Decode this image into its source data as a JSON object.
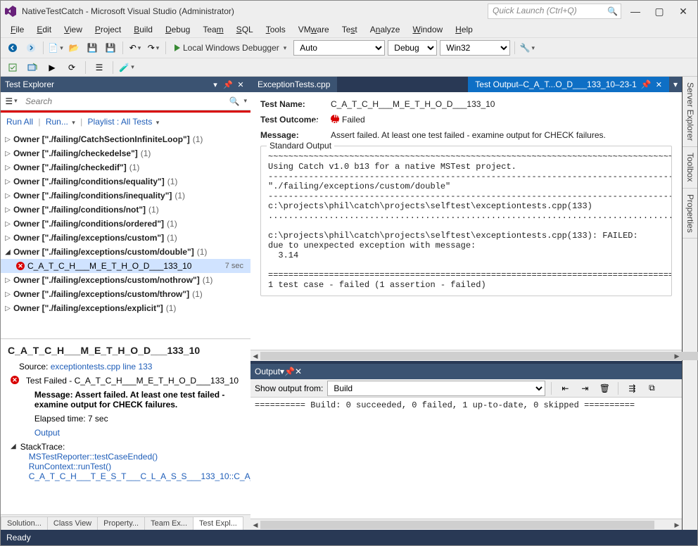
{
  "window": {
    "title": "NativeTestCatch - Microsoft Visual Studio (Administrator)",
    "quick_launch_placeholder": "Quick Launch (Ctrl+Q)"
  },
  "menu": [
    "File",
    "Edit",
    "View",
    "Project",
    "Build",
    "Debug",
    "Team",
    "SQL",
    "Tools",
    "VMware",
    "Test",
    "Analyze",
    "Window",
    "Help"
  ],
  "toolbar": {
    "run_label": "Local Windows Debugger",
    "combo_platform": "Auto",
    "combo_config": "Debug",
    "combo_arch": "Win32"
  },
  "test_explorer": {
    "title": "Test Explorer",
    "search_placeholder": "Search",
    "cmd_runall": "Run All",
    "cmd_run": "Run...",
    "cmd_playlist": "Playlist : All Tests",
    "groups": [
      {
        "label": "Owner [\"./failing/CatchSectionInfiniteLoop\"]",
        "count": "(1)",
        "open": false
      },
      {
        "label": "Owner [\"./failing/checkedelse\"]",
        "count": "(1)",
        "open": false
      },
      {
        "label": "Owner [\"./failing/checkedif\"]",
        "count": "(1)",
        "open": false
      },
      {
        "label": "Owner [\"./failing/conditions/equality\"]",
        "count": "(1)",
        "open": false
      },
      {
        "label": "Owner [\"./failing/conditions/inequality\"]",
        "count": "(1)",
        "open": false
      },
      {
        "label": "Owner [\"./failing/conditions/not\"]",
        "count": "(1)",
        "open": false
      },
      {
        "label": "Owner [\"./failing/conditions/ordered\"]",
        "count": "(1)",
        "open": false
      },
      {
        "label": "Owner [\"./failing/exceptions/custom\"]",
        "count": "(1)",
        "open": false
      },
      {
        "label": "Owner [\"./failing/exceptions/custom/double\"]",
        "count": "(1)",
        "open": true,
        "children": [
          {
            "label": "C_A_T_C_H___M_E_T_H_O_D___133_10",
            "time": "7 sec",
            "failed": true
          }
        ]
      },
      {
        "label": "Owner [\"./failing/exceptions/custom/nothrow\"]",
        "count": "(1)",
        "open": false
      },
      {
        "label": "Owner [\"./failing/exceptions/custom/throw\"]",
        "count": "(1)",
        "open": false
      },
      {
        "label": "Owner [\"./failing/exceptions/explicit\"]",
        "count": "(1)",
        "open": false
      }
    ],
    "detail": {
      "name": "C_A_T_C_H___M_E_T_H_O_D___133_10",
      "source_label": "Source:",
      "source_link": "exceptiontests.cpp line 133",
      "fail_line": "Test Failed - C_A_T_C_H___M_E_T_H_O_D___133_10",
      "message_label": "Message: Assert failed. At least one test failed - examine output for CHECK failures.",
      "elapsed": "Elapsed time: 7 sec",
      "output_link": "Output",
      "stack_label": "StackTrace:",
      "stack": [
        "MSTestReporter::testCaseEnded()",
        "RunContext::runTest()",
        "C_A_T_C_H___T_E_S_T___C_L_A_S_S___133_10::C_A_"
      ]
    }
  },
  "bottom_tabs": [
    "Solution...",
    "Class View",
    "Property...",
    "Team Ex...",
    "Test Expl..."
  ],
  "right_tabs": [
    "Server Explorer",
    "Toolbox",
    "Properties"
  ],
  "editor": {
    "tab_inactive": "ExceptionTests.cpp",
    "tab_active": "Test Output–C_A_T...O_D___133_10–23-1",
    "test_name_label": "Test Name:",
    "test_name": "C_A_T_C_H___M_E_T_H_O_D___133_10",
    "outcome_label": "Test Outcome:",
    "outcome": "Failed",
    "message_label": "Message:",
    "message": "Assert failed. At least one test failed - examine output for CHECK failures.",
    "stdout_legend": "Standard Output",
    "stdout": "~~~~~~~~~~~~~~~~~~~~~~~~~~~~~~~~~~~~~~~~~~~~~~~~~~~~~~~~~~~~~~~~~~~~~~~~~~~~~~~~~~~~~~~~~~~~~~~\nUsing Catch v1.0 b13 for a native MSTest project.\n----------------------------------------------------------------------------------------------\n\"./failing/exceptions/custom/double\"\n----------------------------------------------------------------------------------------------\nc:\\projects\\phil\\catch\\projects\\selftest\\exceptiontests.cpp(133)\n..................................................................................................\n\nc:\\projects\\phil\\catch\\projects\\selftest\\exceptiontests.cpp(133): FAILED:\ndue to unexpected exception with message:\n  3.14\n\n==============================================================================================\n1 test case - failed (1 assertion - failed)"
  },
  "output_panel": {
    "title": "Output",
    "show_from_label": "Show output from:",
    "show_from_value": "Build",
    "body": "========== Build: 0 succeeded, 0 failed, 1 up-to-date, 0 skipped =========="
  },
  "status": {
    "text": "Ready"
  }
}
